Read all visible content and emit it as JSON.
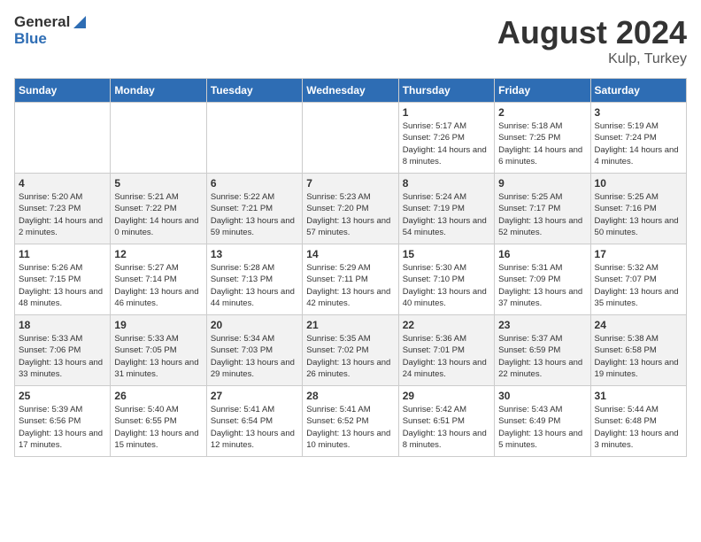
{
  "header": {
    "logo_general": "General",
    "logo_blue": "Blue",
    "month": "August 2024",
    "location": "Kulp, Turkey"
  },
  "days_of_week": [
    "Sunday",
    "Monday",
    "Tuesday",
    "Wednesday",
    "Thursday",
    "Friday",
    "Saturday"
  ],
  "weeks": [
    [
      {
        "day": "",
        "content": ""
      },
      {
        "day": "",
        "content": ""
      },
      {
        "day": "",
        "content": ""
      },
      {
        "day": "",
        "content": ""
      },
      {
        "day": "1",
        "content": "Sunrise: 5:17 AM\nSunset: 7:26 PM\nDaylight: 14 hours and 8 minutes."
      },
      {
        "day": "2",
        "content": "Sunrise: 5:18 AM\nSunset: 7:25 PM\nDaylight: 14 hours and 6 minutes."
      },
      {
        "day": "3",
        "content": "Sunrise: 5:19 AM\nSunset: 7:24 PM\nDaylight: 14 hours and 4 minutes."
      }
    ],
    [
      {
        "day": "4",
        "content": "Sunrise: 5:20 AM\nSunset: 7:23 PM\nDaylight: 14 hours and 2 minutes."
      },
      {
        "day": "5",
        "content": "Sunrise: 5:21 AM\nSunset: 7:22 PM\nDaylight: 14 hours and 0 minutes."
      },
      {
        "day": "6",
        "content": "Sunrise: 5:22 AM\nSunset: 7:21 PM\nDaylight: 13 hours and 59 minutes."
      },
      {
        "day": "7",
        "content": "Sunrise: 5:23 AM\nSunset: 7:20 PM\nDaylight: 13 hours and 57 minutes."
      },
      {
        "day": "8",
        "content": "Sunrise: 5:24 AM\nSunset: 7:19 PM\nDaylight: 13 hours and 54 minutes."
      },
      {
        "day": "9",
        "content": "Sunrise: 5:25 AM\nSunset: 7:17 PM\nDaylight: 13 hours and 52 minutes."
      },
      {
        "day": "10",
        "content": "Sunrise: 5:25 AM\nSunset: 7:16 PM\nDaylight: 13 hours and 50 minutes."
      }
    ],
    [
      {
        "day": "11",
        "content": "Sunrise: 5:26 AM\nSunset: 7:15 PM\nDaylight: 13 hours and 48 minutes."
      },
      {
        "day": "12",
        "content": "Sunrise: 5:27 AM\nSunset: 7:14 PM\nDaylight: 13 hours and 46 minutes."
      },
      {
        "day": "13",
        "content": "Sunrise: 5:28 AM\nSunset: 7:13 PM\nDaylight: 13 hours and 44 minutes."
      },
      {
        "day": "14",
        "content": "Sunrise: 5:29 AM\nSunset: 7:11 PM\nDaylight: 13 hours and 42 minutes."
      },
      {
        "day": "15",
        "content": "Sunrise: 5:30 AM\nSunset: 7:10 PM\nDaylight: 13 hours and 40 minutes."
      },
      {
        "day": "16",
        "content": "Sunrise: 5:31 AM\nSunset: 7:09 PM\nDaylight: 13 hours and 37 minutes."
      },
      {
        "day": "17",
        "content": "Sunrise: 5:32 AM\nSunset: 7:07 PM\nDaylight: 13 hours and 35 minutes."
      }
    ],
    [
      {
        "day": "18",
        "content": "Sunrise: 5:33 AM\nSunset: 7:06 PM\nDaylight: 13 hours and 33 minutes."
      },
      {
        "day": "19",
        "content": "Sunrise: 5:33 AM\nSunset: 7:05 PM\nDaylight: 13 hours and 31 minutes."
      },
      {
        "day": "20",
        "content": "Sunrise: 5:34 AM\nSunset: 7:03 PM\nDaylight: 13 hours and 29 minutes."
      },
      {
        "day": "21",
        "content": "Sunrise: 5:35 AM\nSunset: 7:02 PM\nDaylight: 13 hours and 26 minutes."
      },
      {
        "day": "22",
        "content": "Sunrise: 5:36 AM\nSunset: 7:01 PM\nDaylight: 13 hours and 24 minutes."
      },
      {
        "day": "23",
        "content": "Sunrise: 5:37 AM\nSunset: 6:59 PM\nDaylight: 13 hours and 22 minutes."
      },
      {
        "day": "24",
        "content": "Sunrise: 5:38 AM\nSunset: 6:58 PM\nDaylight: 13 hours and 19 minutes."
      }
    ],
    [
      {
        "day": "25",
        "content": "Sunrise: 5:39 AM\nSunset: 6:56 PM\nDaylight: 13 hours and 17 minutes."
      },
      {
        "day": "26",
        "content": "Sunrise: 5:40 AM\nSunset: 6:55 PM\nDaylight: 13 hours and 15 minutes."
      },
      {
        "day": "27",
        "content": "Sunrise: 5:41 AM\nSunset: 6:54 PM\nDaylight: 13 hours and 12 minutes."
      },
      {
        "day": "28",
        "content": "Sunrise: 5:41 AM\nSunset: 6:52 PM\nDaylight: 13 hours and 10 minutes."
      },
      {
        "day": "29",
        "content": "Sunrise: 5:42 AM\nSunset: 6:51 PM\nDaylight: 13 hours and 8 minutes."
      },
      {
        "day": "30",
        "content": "Sunrise: 5:43 AM\nSunset: 6:49 PM\nDaylight: 13 hours and 5 minutes."
      },
      {
        "day": "31",
        "content": "Sunrise: 5:44 AM\nSunset: 6:48 PM\nDaylight: 13 hours and 3 minutes."
      }
    ]
  ]
}
